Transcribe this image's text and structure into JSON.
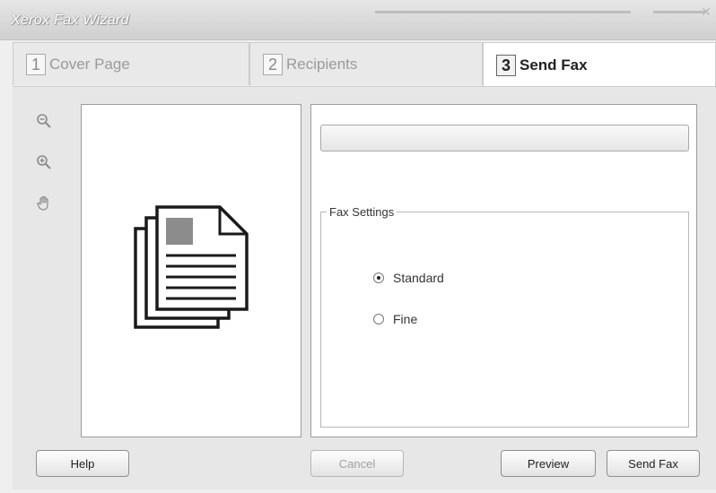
{
  "window": {
    "title": "Xerox Fax Wizard"
  },
  "tabs": [
    {
      "number": "1",
      "label": "Cover Page",
      "active": false
    },
    {
      "number": "2",
      "label": "Recipients",
      "active": false
    },
    {
      "number": "3",
      "label": "Send Fax",
      "active": true
    }
  ],
  "toolbar": {
    "tools": [
      "zoom-out-icon",
      "zoom-in-icon",
      "hand-pan-icon"
    ]
  },
  "preview": {
    "icon": "document-stack-icon"
  },
  "progress": {
    "value": 0
  },
  "fax_settings": {
    "legend": "Fax Settings",
    "options": [
      {
        "label": "Standard",
        "selected": true
      },
      {
        "label": "Fine",
        "selected": false
      }
    ]
  },
  "buttons": {
    "help": "Help",
    "cancel": "Cancel",
    "preview": "Preview",
    "send_fax": "Send Fax"
  },
  "colors": {
    "background": "#efefef",
    "panel": "#ffffff",
    "progress_fill": "#7ea0d0"
  }
}
